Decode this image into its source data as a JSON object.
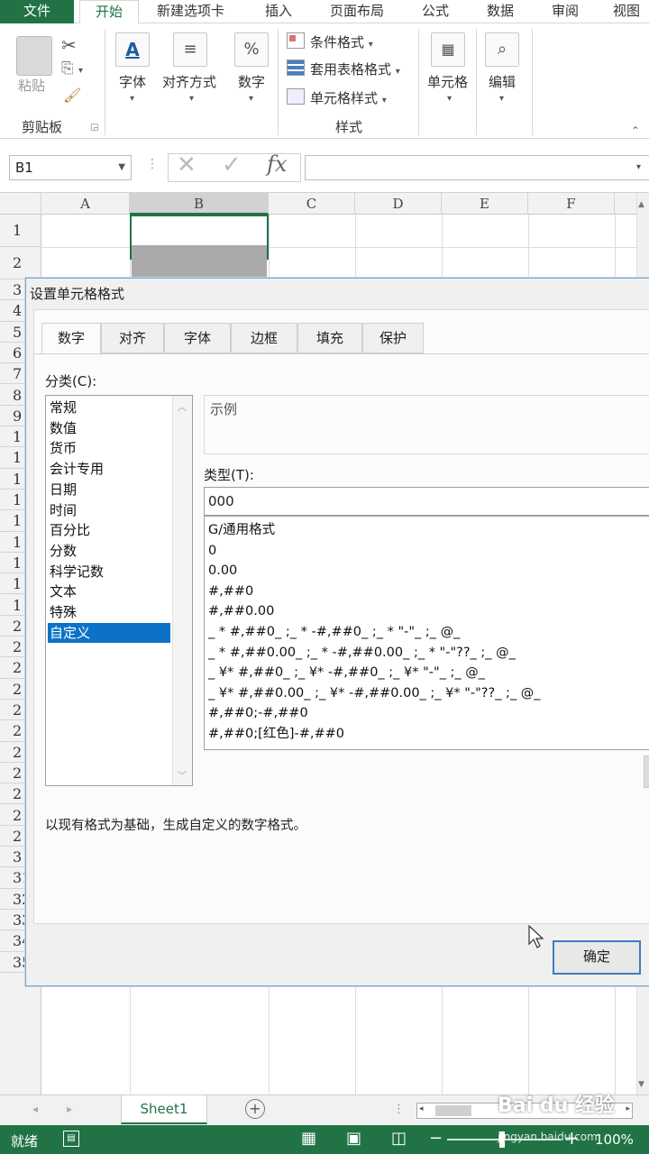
{
  "ribbon_tabs": [
    "文件",
    "开始",
    "新建选项卡",
    "插入",
    "页面布局",
    "公式",
    "数据",
    "审阅",
    "视图"
  ],
  "ribbon": {
    "paste": "粘贴",
    "clipboard": "剪贴板",
    "font": "字体",
    "alignment": "对齐方式",
    "number": "数字",
    "cond_format": "条件格式",
    "table_format": "套用表格格式",
    "cell_style": "单元格样式",
    "styles": "样式",
    "cells": "单元格",
    "editing": "编辑"
  },
  "formula_bar": {
    "name_box": "B1",
    "fx": "fx"
  },
  "columns": [
    "A",
    "B",
    "C",
    "D",
    "E",
    "F"
  ],
  "visible_rows": [
    "1",
    "2",
    "3",
    "4",
    "5",
    "6",
    "7",
    "8",
    "9",
    "1",
    "1",
    "1",
    "1",
    "1",
    "1",
    "1",
    "1",
    "1",
    "2",
    "2",
    "2",
    "2",
    "2",
    "2",
    "2",
    "2",
    "2",
    "2",
    "2",
    "3",
    "31",
    "32",
    "33",
    "34",
    "35"
  ],
  "sheet": {
    "tab": "Sheet1"
  },
  "status": {
    "ready": "就绪",
    "zoom": "100%"
  },
  "dialog": {
    "title": "设置单元格格式",
    "tabs": [
      "数字",
      "对齐",
      "字体",
      "边框",
      "填充",
      "保护"
    ],
    "category_label": "分类(C):",
    "categories": [
      "常规",
      "数值",
      "货币",
      "会计专用",
      "日期",
      "时间",
      "百分比",
      "分数",
      "科学记数",
      "文本",
      "特殊",
      "自定义"
    ],
    "selected_category": "自定义",
    "sample_label": "示例",
    "type_label": "类型(T):",
    "type_value": "000",
    "formats": [
      "G/通用格式",
      "0",
      "0.00",
      "#,##0",
      "#,##0.00",
      "_ * #,##0_ ;_ * -#,##0_ ;_ * \"-\"_ ;_ @_",
      "_ * #,##0.00_ ;_ * -#,##0.00_ ;_ * \"-\"??_ ;_ @_",
      "_ ¥* #,##0_ ;_ ¥* -#,##0_ ;_ ¥* \"-\"_ ;_ @_",
      "_ ¥* #,##0.00_ ;_ ¥* -#,##0.00_ ;_ ¥* \"-\"??_ ;_ @_",
      "#,##0;-#,##0",
      "#,##0;[红色]-#,##0"
    ],
    "description": "以现有格式为基础，生成自定义的数字格式。",
    "ok": "确定"
  },
  "watermark": {
    "text": "Bai du 经验",
    "url": "jingyan.baidu.com"
  }
}
